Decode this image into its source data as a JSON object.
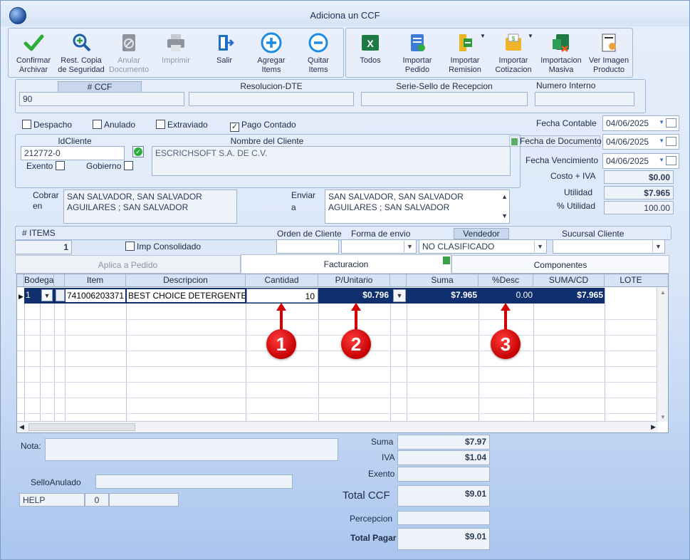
{
  "window": {
    "title": "Adiciona un CCF"
  },
  "toolbar": {
    "left": [
      {
        "label1": "Confirmar",
        "label2": "Archivar"
      },
      {
        "label1": "Rest. Copia",
        "label2": "de Seguridad"
      },
      {
        "label1": "Anular",
        "label2": "Documento"
      },
      {
        "label1": "Imprimir",
        "label2": ""
      },
      {
        "label1": "Salir",
        "label2": ""
      },
      {
        "label1": "Agregar",
        "label2": "Items"
      },
      {
        "label1": "Quitar",
        "label2": "Items"
      }
    ],
    "right": [
      {
        "label1": "Todos",
        "label2": ""
      },
      {
        "label1": "Importar",
        "label2": "Pedido"
      },
      {
        "label1": "Importar",
        "label2": "Remision"
      },
      {
        "label1": "Importar",
        "label2": "Cotizacion"
      },
      {
        "label1": "Importacion",
        "label2": "Masiva"
      },
      {
        "label1": "Ver Imagen",
        "label2": "Producto"
      }
    ]
  },
  "doc": {
    "ccf_label": "# CCF",
    "ccf_value": "90",
    "resolucion_label": "Resolucion-DTE",
    "resolucion_value": "",
    "serie_label": "Serie-Sello de Recepcion",
    "serie_value": "",
    "numint_label": "Numero Interno",
    "numint_value": ""
  },
  "flags": {
    "despacho": "Despacho",
    "anulado": "Anulado",
    "extraviado": "Extraviado",
    "pago_contado": "Pago Contado"
  },
  "dates": {
    "contable_label": "Fecha Contable",
    "contable_value": "04/06/2025",
    "documento_label": "Fecha de  Documento",
    "documento_value": "04/06/2025",
    "vencimiento_label": "Fecha Vencimiento",
    "vencimiento_value": "04/06/2025"
  },
  "client": {
    "id_label": "IdCliente",
    "id_value": "212772-0",
    "name_label": "Nombre del Cliente",
    "name_value": "ESCRICHSOFT S.A. DE C.V.",
    "exento_label": "Exento",
    "gobierno_label": "Gobierno"
  },
  "metrics": {
    "costo_label": "Costo + IVA",
    "costo_value": "$0.00",
    "utilidad_label": "Utilidad",
    "utilidad_value": "$7.965",
    "putil_label": "% Utilidad",
    "putil_value": "100.00"
  },
  "address": {
    "cobrar_label1": "Cobrar",
    "cobrar_label2": "en",
    "cobrar_line1": "SAN SALVADOR, SAN SALVADOR",
    "cobrar_line2": "AGUILARES ; SAN SALVADOR",
    "enviar_label1": "Enviar",
    "enviar_label2": "a",
    "enviar_line1": "SAN SALVADOR, SAN SALVADOR",
    "enviar_line2": "AGUILARES ; SAN SALVADOR"
  },
  "order": {
    "items_label": "# ITEMS",
    "items_value": "1",
    "imp_consolidado": "Imp Consolidado",
    "orden_label": "Orden de Cliente",
    "orden_value": "",
    "envio_label": "Forma de envio",
    "envio_value": "",
    "vendedor_label": "Vendedor",
    "vendedor_value": "NO CLASIFICADO",
    "sucursal_label": "Sucursal Cliente",
    "sucursal_value": ""
  },
  "tabs": {
    "aplica": "Aplica a Pedido",
    "facturacion": "Facturacion",
    "componentes": "Componentes"
  },
  "grid": {
    "headers": {
      "bodega": "Bodega",
      "item": "Item",
      "descripcion": "Descripcion",
      "cantidad": "Cantidad",
      "punitario": "P/Unitario",
      "suma": "Suma",
      "desc": "%Desc",
      "sumacd": "SUMA/CD",
      "lote": "LOTE"
    },
    "row": {
      "bodega": "1",
      "item": "741006203371",
      "descripcion": "BEST CHOICE DETERGENTE",
      "cantidad": "10",
      "punitario": "$0.796",
      "suma": "$7.965",
      "desc": "0.00",
      "sumacd": "$7.965"
    }
  },
  "callouts": [
    "1",
    "2",
    "3"
  ],
  "footer": {
    "nota_label": "Nota:",
    "nota_value": "",
    "sello_label": "SelloAnulado",
    "sello_value": "",
    "help_label": "HELP",
    "help_count": "0"
  },
  "totals": {
    "suma_label": "Suma",
    "suma_value": "$7.97",
    "iva_label": "IVA",
    "iva_value": "$1.04",
    "exento_label": "Exento",
    "exento_value": "",
    "total_ccf_label": "Total CCF",
    "total_ccf_value": "$9.01",
    "percepcion_label": "Percepcion",
    "percepcion_value": "",
    "total_pagar_label": "Total Pagar",
    "total_pagar_value": "$9.01"
  }
}
